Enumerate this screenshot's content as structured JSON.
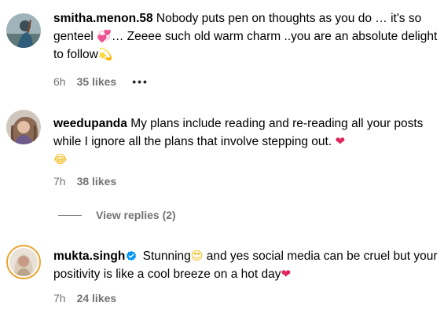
{
  "comments": [
    {
      "username": "smitha.menon.58",
      "text_1": " Nobody puts pen on thoughts as you do … it's so genteel ",
      "emoji_1": "💞",
      "text_2": "… Zeeee such old warm charm ..you are an absolute delight to follow",
      "emoji_2": "💫",
      "time": "6h",
      "likes": "35 likes",
      "more": "•••"
    },
    {
      "username": "weedupanda",
      "text_1": " My plans include reading and re-reading all your posts while I ignore all the plans that involve stepping out. ",
      "emoji_1": "❤",
      "emoji_2": "😂",
      "time": "7h",
      "likes": "38 likes",
      "replies_label": "View replies (2)"
    },
    {
      "username": "mukta.singh",
      "verified": true,
      "text_1": " Stunning",
      "emoji_1": "😍",
      "text_2": " and yes social media can be cruel but your positivity is like a cool breeze on a hot day",
      "emoji_2": "❤",
      "time": "7h",
      "likes": "24 likes"
    }
  ],
  "colors": {
    "meta_gray": "#737373",
    "verified_blue": "#0095f6",
    "heart_red": "#e0245e",
    "story_ring": "#e8a32c"
  }
}
